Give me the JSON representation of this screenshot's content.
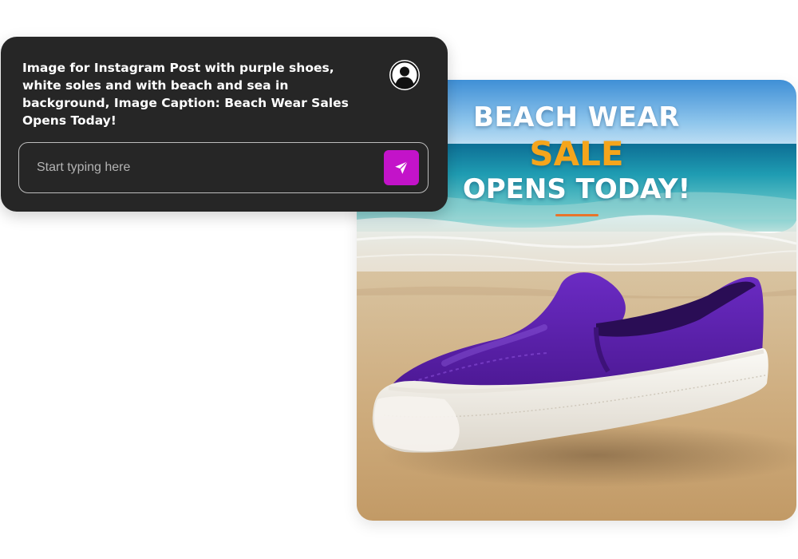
{
  "prompt": {
    "text": "Image for Instagram Post with purple shoes, white soles and with beach and sea in background, Image Caption: Beach Wear Sales Opens Today!",
    "avatar_icon": "user-silhouette-icon"
  },
  "input": {
    "placeholder": "Start typing here",
    "value": "",
    "send_icon": "paper-plane-icon"
  },
  "generated_image": {
    "headline_line1": "Beach Wear",
    "headline_line2": "Sale",
    "headline_line3": "Opens Today!",
    "subject": "purple slip-on shoe with white sole on sandy beach"
  },
  "colors": {
    "panel_bg": "#262626",
    "send_button": "#c313c9",
    "sale_text": "#f5a51c",
    "accent_rule": "#e8742a",
    "shoe_purple": "#5a1fa8",
    "sole_white": "#f3f1ec"
  }
}
